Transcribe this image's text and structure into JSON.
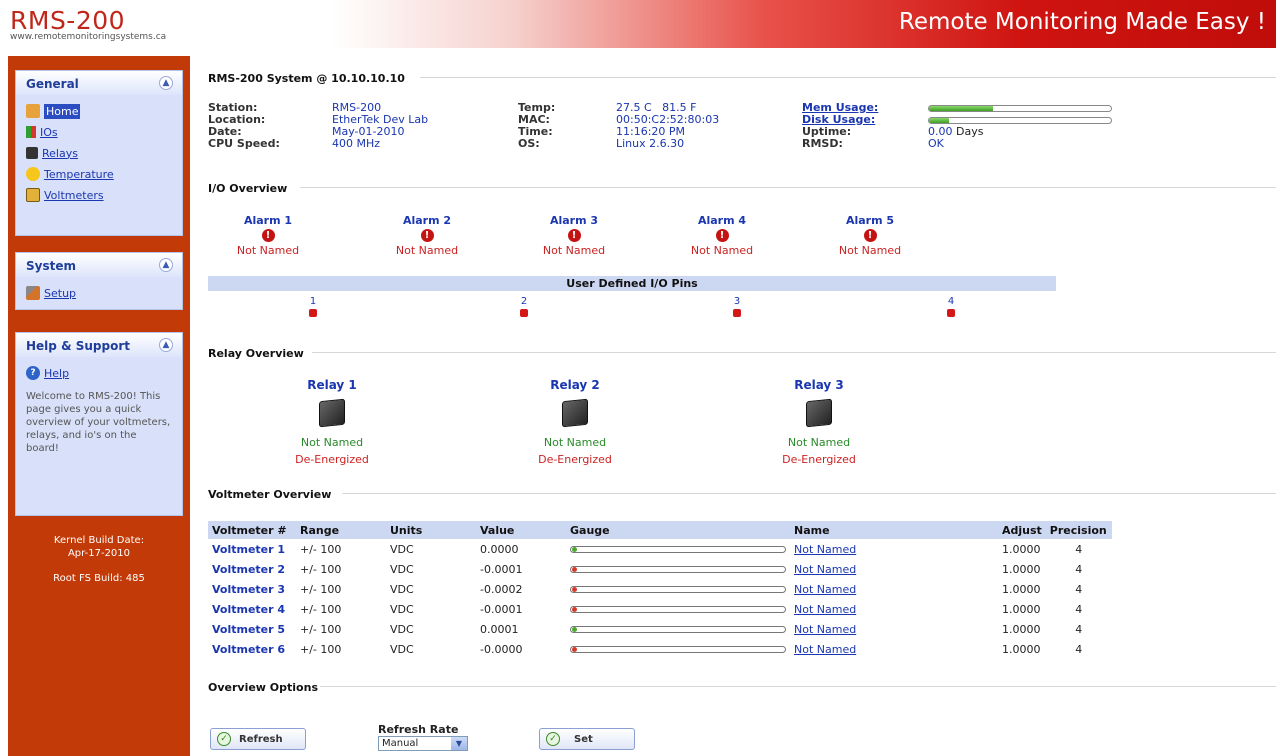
{
  "header": {
    "logo": "RMS-200",
    "url": "www.remotemonitoringsystems.ca",
    "tagline": "Remote Monitoring Made Easy !"
  },
  "sidebar": {
    "general": {
      "title": "General",
      "items": [
        {
          "label": "Home",
          "icon": "home-icon"
        },
        {
          "label": "IOs",
          "icon": "io-icon"
        },
        {
          "label": "Relays",
          "icon": "relay-icon"
        },
        {
          "label": "Temperature",
          "icon": "temperature-icon"
        },
        {
          "label": "Voltmeters",
          "icon": "voltmeter-icon"
        }
      ]
    },
    "system": {
      "title": "System",
      "items": [
        {
          "label": "Setup",
          "icon": "wrench-icon"
        }
      ]
    },
    "help": {
      "title": "Help & Support",
      "items": [
        {
          "label": "Help",
          "icon": "help-icon"
        }
      ],
      "text": "Welcome to RMS-200! This page gives you a quick overview of your voltmeters, relays, and io's on the board!"
    },
    "kernel_label": "Kernel Build Date:",
    "kernel_date": "Apr-17-2010",
    "rootfs": "Root FS Build: 485"
  },
  "system": {
    "title": "RMS-200 System @ 10.10.10.10",
    "col1": [
      {
        "label": "Station:",
        "value": "RMS-200"
      },
      {
        "label": "Location:",
        "value": "EtherTek Dev Lab"
      },
      {
        "label": "Date:",
        "value": "May-01-2010"
      },
      {
        "label": "CPU Speed:",
        "value": "400 MHz"
      }
    ],
    "col2": [
      {
        "label": "Temp:",
        "value": "27.5 C   81.5 F"
      },
      {
        "label": "MAC:",
        "value": "00:50:C2:52:80:03"
      },
      {
        "label": "Time:",
        "value": "11:16:20 PM"
      },
      {
        "label": "OS:",
        "value": "Linux 2.6.30"
      }
    ],
    "mem_label": "Mem Usage:",
    "mem_fraction": 0.35,
    "disk_label": "Disk Usage:",
    "disk_fraction": 0.11,
    "uptime_label": "Uptime:",
    "uptime_value": "0.00",
    "uptime_unit": "Days",
    "rmsd_label": "RMSD:",
    "rmsd_value": "OK"
  },
  "io": {
    "title": "I/O Overview",
    "alarms": [
      {
        "name": "Alarm 1",
        "state": "Not Named"
      },
      {
        "name": "Alarm 2",
        "state": "Not Named"
      },
      {
        "name": "Alarm 3",
        "state": "Not Named"
      },
      {
        "name": "Alarm 4",
        "state": "Not Named"
      },
      {
        "name": "Alarm 5",
        "state": "Not Named"
      }
    ],
    "pins_title": "User Defined I/O Pins",
    "pins": [
      "1",
      "2",
      "3",
      "4"
    ]
  },
  "relay": {
    "title": "Relay Overview",
    "relays": [
      {
        "name": "Relay 1",
        "label": "Not Named",
        "state": "De-Energized"
      },
      {
        "name": "Relay 2",
        "label": "Not Named",
        "state": "De-Energized"
      },
      {
        "name": "Relay 3",
        "label": "Not Named",
        "state": "De-Energized"
      }
    ]
  },
  "voltmeter": {
    "title": "Voltmeter Overview",
    "headers": [
      "Voltmeter #",
      "Range",
      "Units",
      "Value",
      "Gauge",
      "Name",
      "Adjust",
      "Precision"
    ],
    "rows": [
      {
        "name": "Voltmeter 1",
        "range": "+/- 100",
        "units": "VDC",
        "value": "0.0000",
        "link": "Not Named",
        "adjust": "1.0000",
        "precision": "4",
        "gauge_color": "#4aa82b"
      },
      {
        "name": "Voltmeter 2",
        "range": "+/- 100",
        "units": "VDC",
        "value": "-0.0001",
        "link": "Not Named",
        "adjust": "1.0000",
        "precision": "4",
        "gauge_color": "#d63a2a"
      },
      {
        "name": "Voltmeter 3",
        "range": "+/- 100",
        "units": "VDC",
        "value": "-0.0002",
        "link": "Not Named",
        "adjust": "1.0000",
        "precision": "4",
        "gauge_color": "#d63a2a"
      },
      {
        "name": "Voltmeter 4",
        "range": "+/- 100",
        "units": "VDC",
        "value": "-0.0001",
        "link": "Not Named",
        "adjust": "1.0000",
        "precision": "4",
        "gauge_color": "#d63a2a"
      },
      {
        "name": "Voltmeter 5",
        "range": "+/- 100",
        "units": "VDC",
        "value": "0.0001",
        "link": "Not Named",
        "adjust": "1.0000",
        "precision": "4",
        "gauge_color": "#4aa82b"
      },
      {
        "name": "Voltmeter 6",
        "range": "+/- 100",
        "units": "VDC",
        "value": "-0.0000",
        "link": "Not Named",
        "adjust": "1.0000",
        "precision": "4",
        "gauge_color": "#d63a2a"
      }
    ]
  },
  "options": {
    "title": "Overview Options",
    "refresh_label": "Refresh",
    "rate_label": "Refresh Rate",
    "rate_value": "Manual",
    "set_label": "Set"
  }
}
